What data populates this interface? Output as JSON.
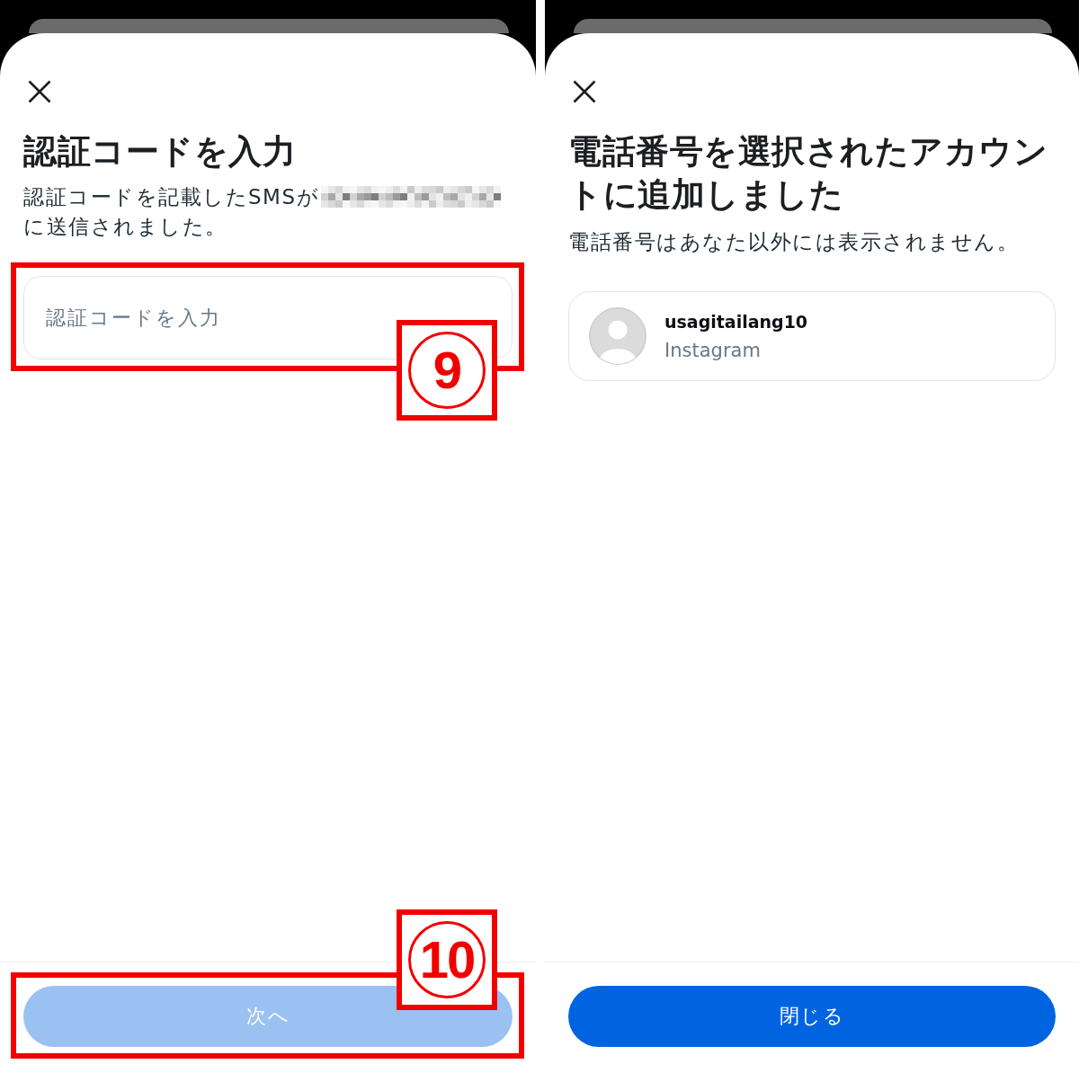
{
  "screens": [
    {
      "title": "認証コードを入力",
      "description": {
        "text_before": "認証コードを記載したSMSが",
        "phone_number_redacted": true,
        "text_after": "に送信されました。"
      },
      "input": {
        "placeholder": "認証コードを入力",
        "annotation": "9"
      },
      "button": {
        "label": "次へ",
        "disabled": true,
        "annotation": "10"
      }
    },
    {
      "title": "電話番号を選択されたアカウントに追加しました",
      "subtitle": "電話番号はあなた以外には表示されません。",
      "account": {
        "username": "usagitailang10",
        "app": "Instagram"
      },
      "button": {
        "label": "閉じる",
        "disabled": false
      }
    }
  ]
}
